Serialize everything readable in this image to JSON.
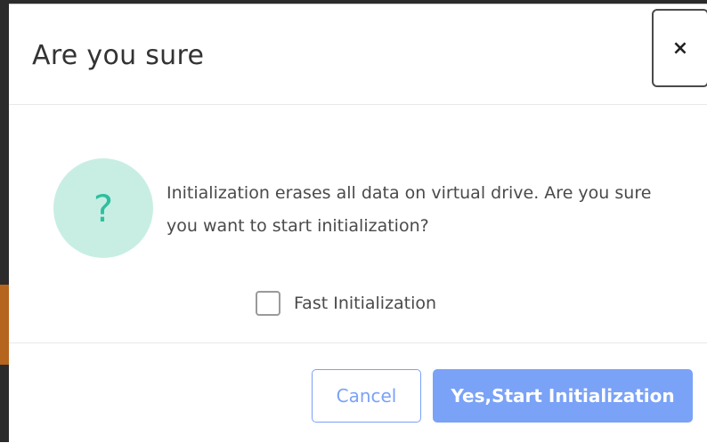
{
  "dialog": {
    "title": "Are you sure",
    "close_label": "×",
    "icon": "question-icon",
    "icon_glyph": "?",
    "message": "Initialization erases all data on virtual drive. Are you sure you want to start initialization?",
    "checkbox_label": "Fast Initialization",
    "checkbox_checked": false,
    "cancel_label": "Cancel",
    "confirm_label": "Yes,Start Initialization"
  },
  "colors": {
    "accent": "#7aa2f7",
    "icon_bg": "#c8eee3",
    "icon_fg": "#2fbfa0"
  }
}
